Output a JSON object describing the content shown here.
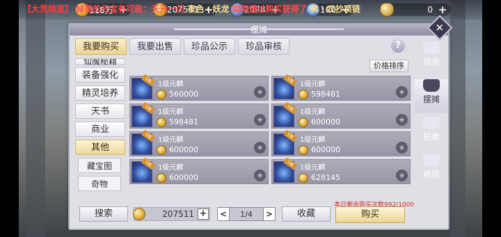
{
  "marquee": {
    "channel": "【大荒频道】",
    "body": "掉落的元宝有可能：天元一闪",
    "names": [
      "夜色",
      "妖龙"
    ],
    "tail": "刚刚通过购买获得了",
    "prize": "佛・叹抄项链"
  },
  "currencies": [
    {
      "icon": "gold-coin-icon",
      "value": "118万"
    },
    {
      "icon": "silver-coin-icon",
      "value": "207511"
    },
    {
      "icon": "blue-gem-icon",
      "value": "2098"
    },
    {
      "icon": "diamond-icon",
      "value": "100"
    },
    {
      "icon": "ingot-icon",
      "value": "0"
    }
  ],
  "panel": {
    "title": "摆摊",
    "help_icon": "?",
    "sort_button": "价格排序",
    "tabs": [
      {
        "label": "我要购买",
        "active": true
      },
      {
        "label": "我要出售",
        "active": false
      },
      {
        "label": "珍品公示",
        "active": false
      },
      {
        "label": "珍品审核",
        "active": false
      }
    ],
    "categories": [
      {
        "label": "仙魔秘籍",
        "partial": true
      },
      {
        "label": "装备强化"
      },
      {
        "label": "精灵培养"
      },
      {
        "label": "天书"
      },
      {
        "label": "商业"
      },
      {
        "label": "其他",
        "active": true
      },
      {
        "label": "藏宝图",
        "sub": true
      },
      {
        "label": "奇物",
        "sub": true
      }
    ],
    "items": [
      {
        "name": "1级元麟",
        "price": "560000",
        "tag": "1级"
      },
      {
        "name": "1级元麟",
        "price": "598481",
        "tag": "1级"
      },
      {
        "name": "1级元麟",
        "price": "598481",
        "tag": "1级"
      },
      {
        "name": "1级元麟",
        "price": "600000",
        "tag": "1级"
      },
      {
        "name": "1级元麟",
        "price": "600000",
        "tag": "1级"
      },
      {
        "name": "1级元麟",
        "price": "600000",
        "tag": "1级"
      },
      {
        "name": "1级元麟",
        "price": "600000",
        "tag": "1级"
      },
      {
        "name": "1级元麟",
        "price": "628145",
        "tag": "1级"
      }
    ],
    "limit_text": "本日剩余购买次数992/1000",
    "bottom": {
      "search": "搜索",
      "money": "207511",
      "page": "1/4",
      "favorite": "收藏",
      "buy": "购买"
    }
  },
  "side_nav": [
    {
      "label": "商会",
      "icon": "guild-icon",
      "active": false
    },
    {
      "label": "摆摊",
      "icon": "stall-bag-icon",
      "active": true
    },
    {
      "label": "拍卖",
      "icon": "auction-icon",
      "active": false
    },
    {
      "label": "商店",
      "icon": "shop-icon",
      "active": false
    }
  ]
}
